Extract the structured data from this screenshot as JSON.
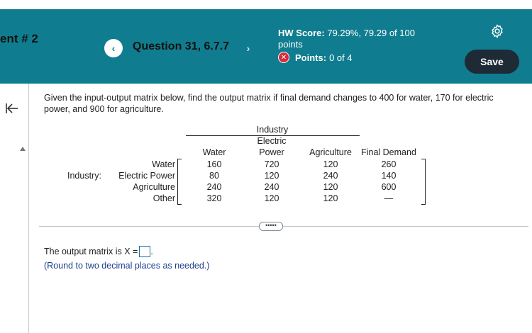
{
  "header": {
    "assignment_title": "ent # 2",
    "question_label": "Question 31, 6.7.7",
    "prev_symbol": "‹",
    "next_symbol": "›",
    "hw_score_label": "HW Score:",
    "hw_score_value": "79.29%, 79.29 of 100",
    "hw_score_unit": "points",
    "points_label": "Points:",
    "points_value": "0 of 4",
    "save_label": "Save"
  },
  "question": {
    "prompt": "Given the input-output matrix below, find the output matrix if final demand changes to 400 for water, 170 for electric power, and 900 for agriculture.",
    "table": {
      "industry_group_label": "Industry",
      "row_group_label": "Industry:",
      "columns": [
        {
          "line1": "",
          "line2": "",
          "line3": "Water"
        },
        {
          "line1": "",
          "line2": "Electric",
          "line3": "Power"
        },
        {
          "line1": "",
          "line2": "",
          "line3": "Agriculture"
        },
        {
          "line1": "",
          "line2": "",
          "line3": "Final Demand"
        }
      ],
      "rows": [
        {
          "label": "Water",
          "values": [
            "160",
            "720",
            "120",
            "260"
          ]
        },
        {
          "label": "Electric Power",
          "values": [
            "80",
            "120",
            "240",
            "140"
          ]
        },
        {
          "label": "Agriculture",
          "values": [
            "240",
            "240",
            "120",
            "600"
          ]
        },
        {
          "label": "Other",
          "values": [
            "320",
            "120",
            "120",
            "—"
          ]
        }
      ]
    },
    "more_symbol": "•••••",
    "answer_prefix": "The output matrix is X =",
    "answer_suffix": ".",
    "hint": "(Round to two decimal places as needed.)"
  }
}
